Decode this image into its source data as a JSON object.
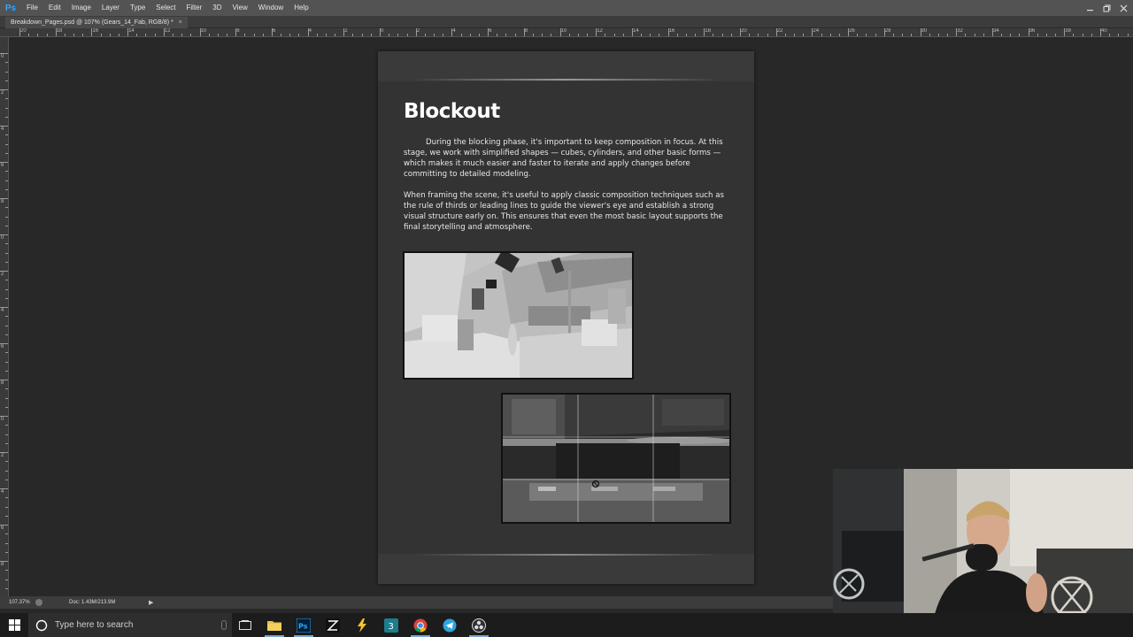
{
  "app": {
    "logo": "Ps",
    "menu": [
      "File",
      "Edit",
      "Image",
      "Layer",
      "Type",
      "Select",
      "Filter",
      "3D",
      "View",
      "Window",
      "Help"
    ],
    "window_controls": [
      "minimize-icon",
      "restore-icon",
      "close-icon"
    ]
  },
  "document_tab": {
    "title": "Breakdown_Pages.psd @ 107% (Gears_14_Fab, RGB/8) *",
    "close": "×"
  },
  "rulers": {
    "top_labels": [
      "20",
      "18",
      "16",
      "14",
      "12",
      "10",
      "8",
      "6",
      "4",
      "2",
      "0",
      "2",
      "4",
      "6",
      "8",
      "10",
      "12",
      "14",
      "16",
      "18",
      "20",
      "22",
      "24",
      "26",
      "28",
      "30",
      "32",
      "34",
      "36",
      "38",
      "40"
    ],
    "left_labels": [
      "0",
      "2",
      "4",
      "6",
      "8",
      "0",
      "2",
      "4",
      "6",
      "8",
      "0",
      "2",
      "4",
      "6",
      "8"
    ]
  },
  "page": {
    "title": "Blockout",
    "paragraph_1": "During the blocking phase, it's important to keep composition in focus. At this stage, we work with simplified shapes — cubes, cylinders, and other basic forms — which makes it much easier and faster to iterate and apply changes before committing to detailed modeling.",
    "paragraph_2": "When framing the scene, it's useful to apply classic composition techniques such as the rule of thirds or leading lines to guide the viewer's eye and establish a strong visual structure early on. This ensures that even the most basic layout supports the final storytelling and atmosphere."
  },
  "status_bar": {
    "zoom": "107.37%",
    "doc_size": "Doc: 1.43M/213.9M",
    "arrow": "▶"
  },
  "taskbar": {
    "search_placeholder": "Type here to search",
    "apps": [
      "task-view-icon",
      "file-explorer-icon",
      "photoshop-icon",
      "inkscape-icon",
      "lightning-app-icon",
      "substance-icon",
      "chrome-icon",
      "telegram-icon",
      "obs-icon"
    ]
  },
  "colors": {
    "menu_bg": "#535353",
    "canvas_bg": "#282828",
    "page_bg": "#333333",
    "accent_ps": "#31a8ff"
  }
}
